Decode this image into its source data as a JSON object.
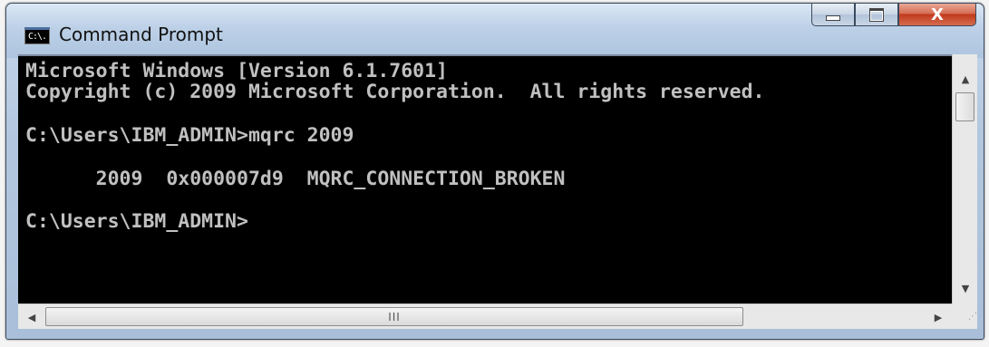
{
  "window": {
    "title": "Command Prompt",
    "icon_text": "C:\\.",
    "close_glyph": "X"
  },
  "console": {
    "lines": [
      "Microsoft Windows [Version 6.1.7601]",
      "Copyright (c) 2009 Microsoft Corporation.  All rights reserved.",
      "",
      "C:\\Users\\IBM_ADMIN>mqrc 2009",
      "",
      "      2009  0x000007d9  MQRC_CONNECTION_BROKEN",
      "",
      "C:\\Users\\IBM_ADMIN>"
    ],
    "background": "#000000",
    "foreground": "#c0c0c0"
  },
  "scrollbars": {
    "up_arrow": "▲",
    "down_arrow": "▼",
    "left_arrow": "◀",
    "right_arrow": "▶",
    "thumb_grip": "III"
  }
}
